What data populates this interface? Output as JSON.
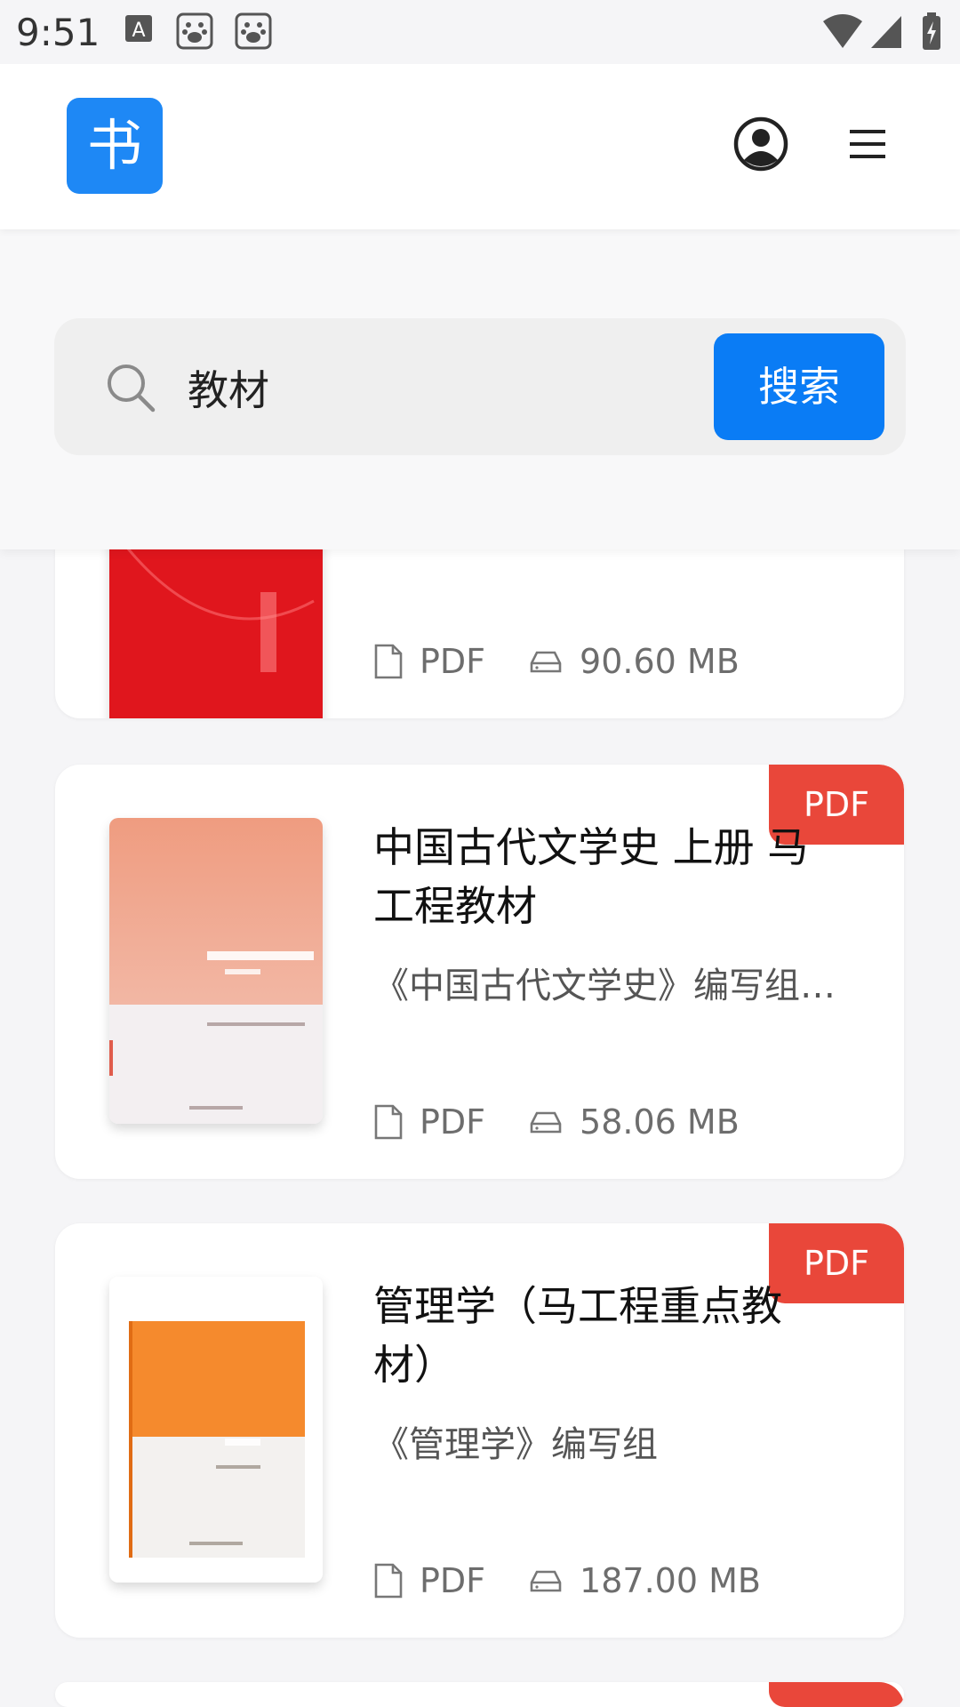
{
  "status_bar": {
    "time": "9:51"
  },
  "header": {
    "logo_text": "书"
  },
  "search": {
    "value": "教材",
    "button_label": "搜索"
  },
  "results": [
    {
      "title": "",
      "author": "",
      "format": "PDF",
      "size": "90.60 MB",
      "badge": ""
    },
    {
      "title": "中国古代文学史 上册 马工程教材",
      "author": "《中国古代文学史》编写组…",
      "format": "PDF",
      "size": "58.06 MB",
      "badge": "PDF"
    },
    {
      "title": "管理学（马工程重点教材）",
      "author": "《管理学》编写组",
      "format": "PDF",
      "size": "187.00 MB",
      "badge": "PDF"
    },
    {
      "badge": ""
    }
  ],
  "colors": {
    "brand": "#1e88f5",
    "search_button": "#0a7cf5",
    "badge": "#e9473a"
  },
  "icons": {
    "file": "file-icon",
    "storage": "hard-drive-icon"
  }
}
